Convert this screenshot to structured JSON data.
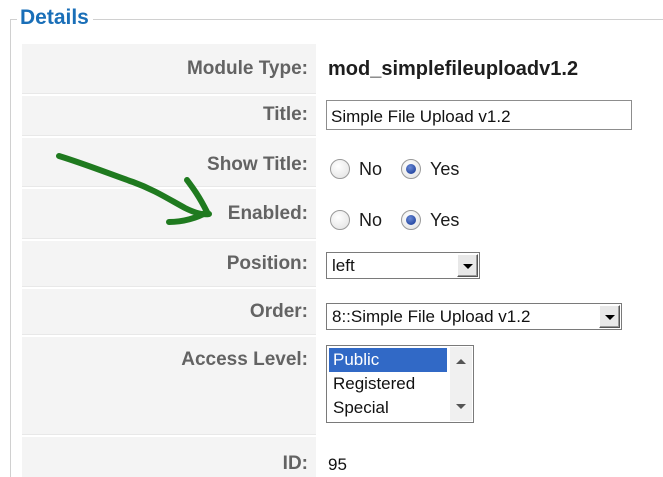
{
  "fieldset": {
    "legend": "Details"
  },
  "rows": {
    "module_type": {
      "label": "Module Type:",
      "value": "mod_simplefileuploadv1.2"
    },
    "title": {
      "label": "Title:",
      "value": "Simple File Upload v1.2"
    },
    "show_title": {
      "label": "Show Title:",
      "options": [
        "No",
        "Yes"
      ],
      "selected": "Yes"
    },
    "enabled": {
      "label": "Enabled:",
      "options": [
        "No",
        "Yes"
      ],
      "selected": "Yes"
    },
    "position": {
      "label": "Position:",
      "selected": "left"
    },
    "order": {
      "label": "Order:",
      "selected": "8::Simple File Upload v1.2"
    },
    "access_level": {
      "label": "Access Level:",
      "options": [
        "Public",
        "Registered",
        "Special"
      ],
      "selected": "Public"
    },
    "id": {
      "label": "ID:",
      "value": "95"
    }
  },
  "annotation": {
    "color": "#1f7a1f"
  }
}
